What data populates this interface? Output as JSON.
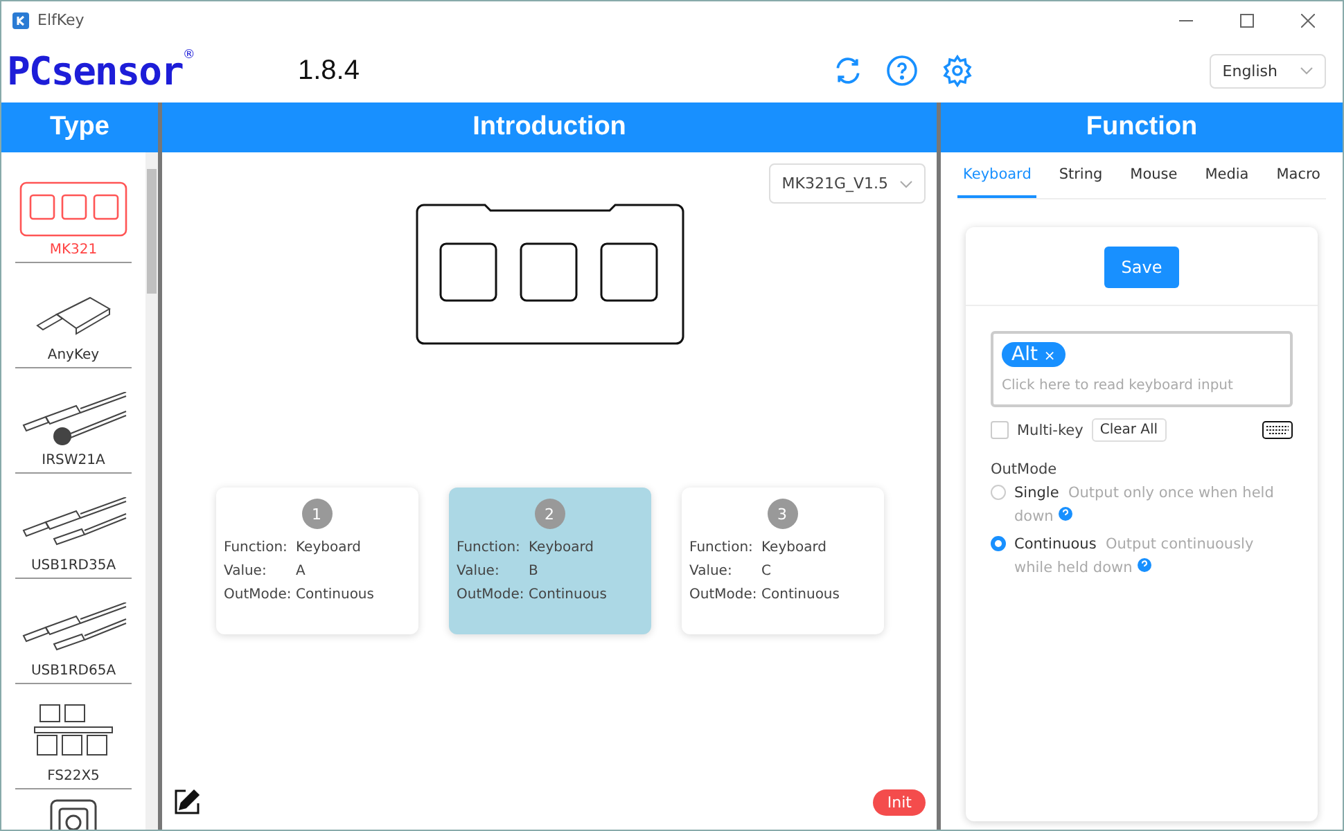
{
  "window": {
    "title": "ElfKey"
  },
  "header": {
    "logo": "PCsensor",
    "logo_mark": "®",
    "version": "1.8.4",
    "language": "English"
  },
  "type_panel": {
    "title": "Type",
    "items": [
      {
        "label": "MK321",
        "kind": "keypad",
        "selected": true
      },
      {
        "label": "AnyKey",
        "kind": "dongle",
        "selected": false
      },
      {
        "label": "IRSW21A",
        "kind": "knob-cable",
        "selected": false
      },
      {
        "label": "USB1RD35A",
        "kind": "jack-cable",
        "selected": false
      },
      {
        "label": "USB1RD65A",
        "kind": "jack-cable",
        "selected": false
      },
      {
        "label": "FS22X5",
        "kind": "pedals",
        "selected": false
      },
      {
        "kind": "single-button",
        "selected": false
      }
    ]
  },
  "intro_panel": {
    "title": "Introduction",
    "model": "MK321G_V1.5",
    "keys": [
      {
        "number": "1",
        "function_label": "Function:",
        "function": "Keyboard",
        "value_label": "Value:",
        "value": "A",
        "outmode_label": "OutMode:",
        "outmode": "Continuous",
        "selected": false
      },
      {
        "number": "2",
        "function_label": "Function:",
        "function": "Keyboard",
        "value_label": "Value:",
        "value": "B",
        "outmode_label": "OutMode:",
        "outmode": "Continuous",
        "selected": true
      },
      {
        "number": "3",
        "function_label": "Function:",
        "function": "Keyboard",
        "value_label": "Value:",
        "value": "C",
        "outmode_label": "OutMode:",
        "outmode": "Continuous",
        "selected": false
      }
    ],
    "init_button": "Init"
  },
  "function_panel": {
    "title": "Function",
    "tabs": [
      {
        "label": "Keyboard",
        "selected": true
      },
      {
        "label": "String",
        "selected": false
      },
      {
        "label": "Mouse",
        "selected": false
      },
      {
        "label": "Media",
        "selected": false
      },
      {
        "label": "Macro",
        "selected": false
      }
    ],
    "save_button": "Save",
    "keys": [
      {
        "label": "Alt",
        "remove": "×"
      }
    ],
    "input_placeholder": "Click here to read keyboard input",
    "multi_key": {
      "label": "Multi-key",
      "checked": false
    },
    "clear_button": "Clear All",
    "outmode_title": "OutMode",
    "outmodes": [
      {
        "label": "Single",
        "hint": "Output only once when held down",
        "selected": false
      },
      {
        "label": "Continuous",
        "hint": "Output continuously while held down",
        "selected": true
      }
    ]
  }
}
